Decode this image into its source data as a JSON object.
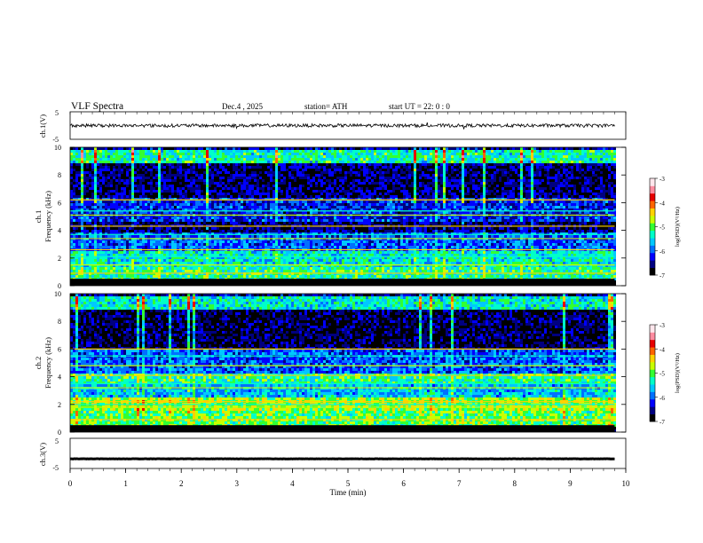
{
  "header": {
    "title": "VLF  Spectra",
    "date": "Dec.4  , 2025",
    "station": "station= ATH",
    "start_ut": "start  UT  =    22: 0   : 0"
  },
  "panels": {
    "ch1_wave": {
      "ylabel": "ch.1(V)",
      "yticks": [
        "5",
        "-5"
      ]
    },
    "ch1_spec": {
      "ylabel_channel": "ch.1",
      "ylabel": "Frequency  (kHz)"
    },
    "ch2_spec": {
      "ylabel_channel": "ch.2",
      "ylabel": "Frequency  (kHz)"
    },
    "ch3_wave": {
      "ylabel": "ch.3(V)",
      "yticks": [
        "5",
        "-5"
      ]
    }
  },
  "colorbar": {
    "label": "log(PSD)(V²/Hz)",
    "ticks": [
      "-3",
      "-4",
      "-5",
      "-6",
      "-7"
    ],
    "colors": [
      "#000000",
      "#000080",
      "#0000ff",
      "#0070ff",
      "#00c8ff",
      "#00ffc8",
      "#32ff32",
      "#c8ff00",
      "#ffd200",
      "#ff6400",
      "#e60000",
      "#ff8ca0",
      "#ffe6ec"
    ]
  },
  "chart_data": [
    {
      "type": "line",
      "title": "ch.1(V)",
      "xlabel": "Time  (min)",
      "ylabel": "ch.1(V)",
      "xlim": [
        0,
        10
      ],
      "ylim": [
        -5,
        5
      ],
      "series": [
        {
          "name": "ch.1",
          "baseline": 0,
          "noise_amplitude": 0.6,
          "x_end": 9.8
        }
      ]
    },
    {
      "type": "heatmap",
      "title": "ch.1",
      "xlabel": "Time  (min)",
      "ylabel": "Frequency  (kHz)",
      "xlim": [
        0,
        10
      ],
      "ylim": [
        0,
        10
      ],
      "yticks": [
        0,
        2,
        4,
        6,
        8,
        10
      ],
      "zlim": [
        -7,
        -3
      ],
      "x_end": 9.8,
      "bands_khz": [
        {
          "from": 0,
          "to": 0.5,
          "log_psd": -6.8
        },
        {
          "from": 0.5,
          "to": 1.5,
          "log_psd": -5.2
        },
        {
          "from": 1.5,
          "to": 2.6,
          "log_psd": -5.4
        },
        {
          "from": 2.6,
          "to": 4.0,
          "log_psd": -6.0
        },
        {
          "from": 4.0,
          "to": 4.8,
          "log_psd": -6.6
        },
        {
          "from": 4.8,
          "to": 6.5,
          "log_psd": -6.2
        },
        {
          "from": 6.5,
          "to": 9.0,
          "log_psd": -6.6
        },
        {
          "from": 9.0,
          "to": 10,
          "log_psd": -5.3
        }
      ],
      "lines_khz": [
        0.9,
        1.5,
        2.1,
        2.6,
        3.4,
        3.7,
        4.3,
        5.1,
        5.4,
        6.2
      ]
    },
    {
      "type": "heatmap",
      "title": "ch.2",
      "xlabel": "Time  (min)",
      "ylabel": "Frequency  (kHz)",
      "xlim": [
        0,
        10
      ],
      "ylim": [
        0,
        10
      ],
      "yticks": [
        0,
        2,
        4,
        6,
        8,
        10
      ],
      "zlim": [
        -7,
        -3
      ],
      "x_end": 9.8,
      "bands_khz": [
        {
          "from": 0,
          "to": 0.5,
          "log_psd": -6.8
        },
        {
          "from": 0.5,
          "to": 1.6,
          "log_psd": -5.0
        },
        {
          "from": 1.6,
          "to": 2.6,
          "log_psd": -4.8
        },
        {
          "from": 2.6,
          "to": 3.6,
          "log_psd": -5.6
        },
        {
          "from": 3.6,
          "to": 4.3,
          "log_psd": -5.2
        },
        {
          "from": 4.3,
          "to": 6.0,
          "log_psd": -6.0
        },
        {
          "from": 6.0,
          "to": 9.0,
          "log_psd": -6.7
        },
        {
          "from": 9.0,
          "to": 10,
          "log_psd": -5.4
        }
      ],
      "lines_khz": [
        0.9,
        1.8,
        2.0,
        2.2,
        3.2,
        3.5,
        4.1,
        4.8,
        5.5,
        6.0
      ]
    },
    {
      "type": "line",
      "title": "ch.3(V)",
      "xlabel": "Time  (min)",
      "ylabel": "ch.3(V)",
      "xlim": [
        0,
        10
      ],
      "ylim": [
        -5,
        5
      ],
      "xticks": [
        0,
        1,
        2,
        3,
        4,
        5,
        6,
        7,
        8,
        9,
        10
      ],
      "series": [
        {
          "name": "ch.3",
          "baseline": -1.8,
          "noise_amplitude": 0.05,
          "x_end": 9.8
        }
      ]
    }
  ]
}
